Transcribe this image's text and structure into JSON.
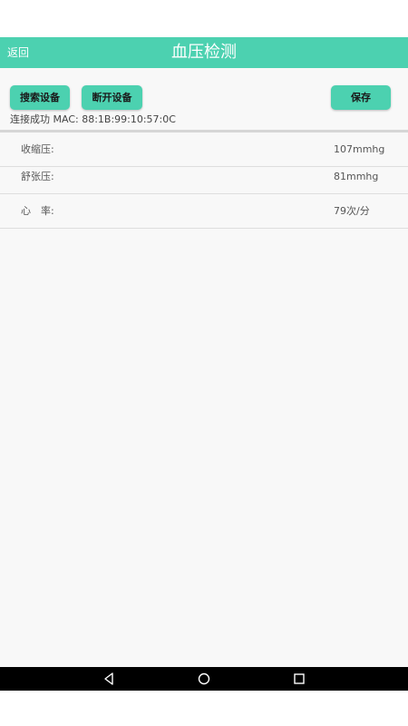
{
  "header": {
    "back_label": "返回",
    "title": "血压检测"
  },
  "toolbar": {
    "search_label": "搜索设备",
    "disconnect_label": "断开设备",
    "save_label": "保存"
  },
  "connection": {
    "status": "连接成功 MAC: 88:1B:99:10:57:0C"
  },
  "readings": [
    {
      "label": "收缩压:",
      "value": "107mmhg"
    },
    {
      "label": "舒张压:",
      "value": "81mmhg"
    },
    {
      "label": "心　率:",
      "value": "79次/分"
    }
  ],
  "colors": {
    "accent": "#4cd1b0",
    "background": "#f8f8f8",
    "nav_bar": "#000000"
  },
  "nav": {
    "icons": [
      "back-triangle-icon",
      "home-circle-icon",
      "recent-square-icon"
    ]
  }
}
